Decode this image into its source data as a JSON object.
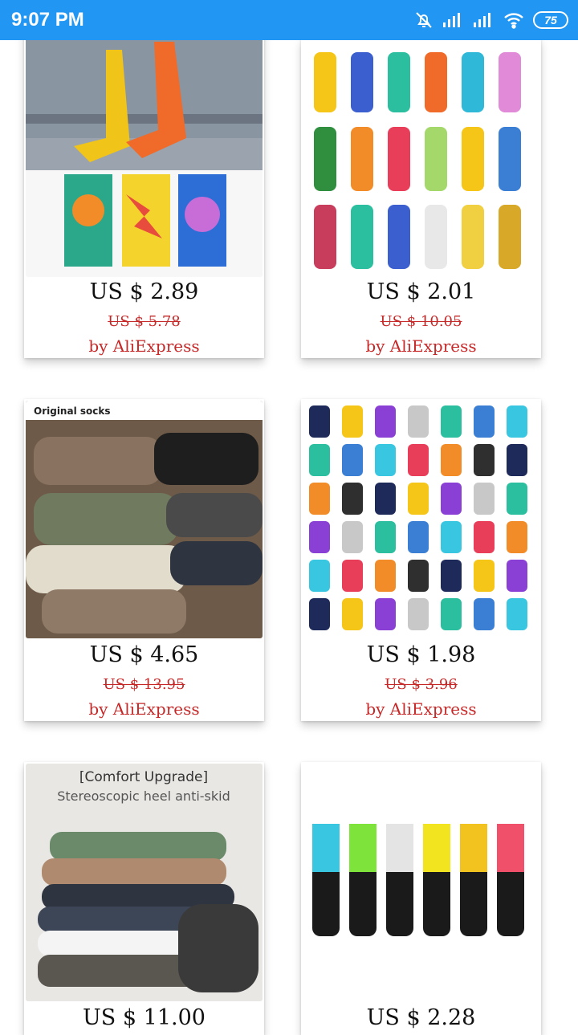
{
  "status_bar": {
    "time": "9:07 PM",
    "battery": "75",
    "icons": [
      "alarm-off-icon",
      "signal-icon",
      "signal-icon",
      "wifi-icon",
      "battery-icon"
    ]
  },
  "products": [
    {
      "price": "US $ 2.89",
      "original_price": "US $ 5.78",
      "seller": "by AliExpress",
      "image": "colorful-camo-socks"
    },
    {
      "price": "US $ 2.01",
      "original_price": "US $ 10.05",
      "seller": "by AliExpress",
      "image": "patterned-socks-grid"
    },
    {
      "price": "US $ 4.65",
      "original_price": "US $ 13.95",
      "seller": "by AliExpress",
      "image": "ribbed-socks-stack",
      "image_text": "Original socks"
    },
    {
      "price": "US $ 1.98",
      "original_price": "US $ 3.96",
      "seller": "by AliExpress",
      "image": "novelty-socks-grid"
    },
    {
      "price": "US $ 11.00",
      "original_price": "",
      "seller": "",
      "image": "comfort-socks-stack",
      "image_text_1": "[Comfort Upgrade]",
      "image_text_2": "Stereoscopic heel anti-skid"
    },
    {
      "price": "US $ 2.28",
      "original_price": "",
      "seller": "",
      "image": "striped-knee-socks"
    }
  ],
  "colors": {
    "status_bar": "#2196f3",
    "price_red": "#c62828"
  }
}
